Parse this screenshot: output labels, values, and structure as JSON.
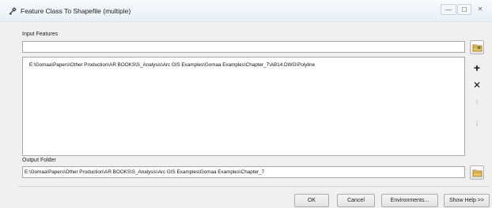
{
  "window": {
    "title": "Feature Class To Shapefile (multiple)",
    "min_label": "—",
    "max_label": "☐",
    "close_label": "✕"
  },
  "input": {
    "label": "Input Features",
    "value": "",
    "items": [
      "E:\\Gomaa\\Papers\\Other Production\\AR BOOKS\\S_Analysis\\Arc GIS Examples\\Gomaa Examples\\Chapter_7\\AB14.DWG\\Polyline"
    ]
  },
  "output": {
    "label": "Output Folder",
    "value": "E:\\Gomaa\\Papers\\Other Production\\AR BOOKS\\S_Analysis\\Arc GIS Examples\\Gomaa Examples\\Chapter_7"
  },
  "buttons": {
    "ok": "OK",
    "cancel": "Cancel",
    "environments": "Environments...",
    "show_help": "Show Help >>"
  },
  "icons": {
    "title": "tool-icon",
    "browse": "folder-icon",
    "add": "plus-icon",
    "remove": "x-icon",
    "up": "arrow-up-icon",
    "down": "arrow-down-icon"
  }
}
